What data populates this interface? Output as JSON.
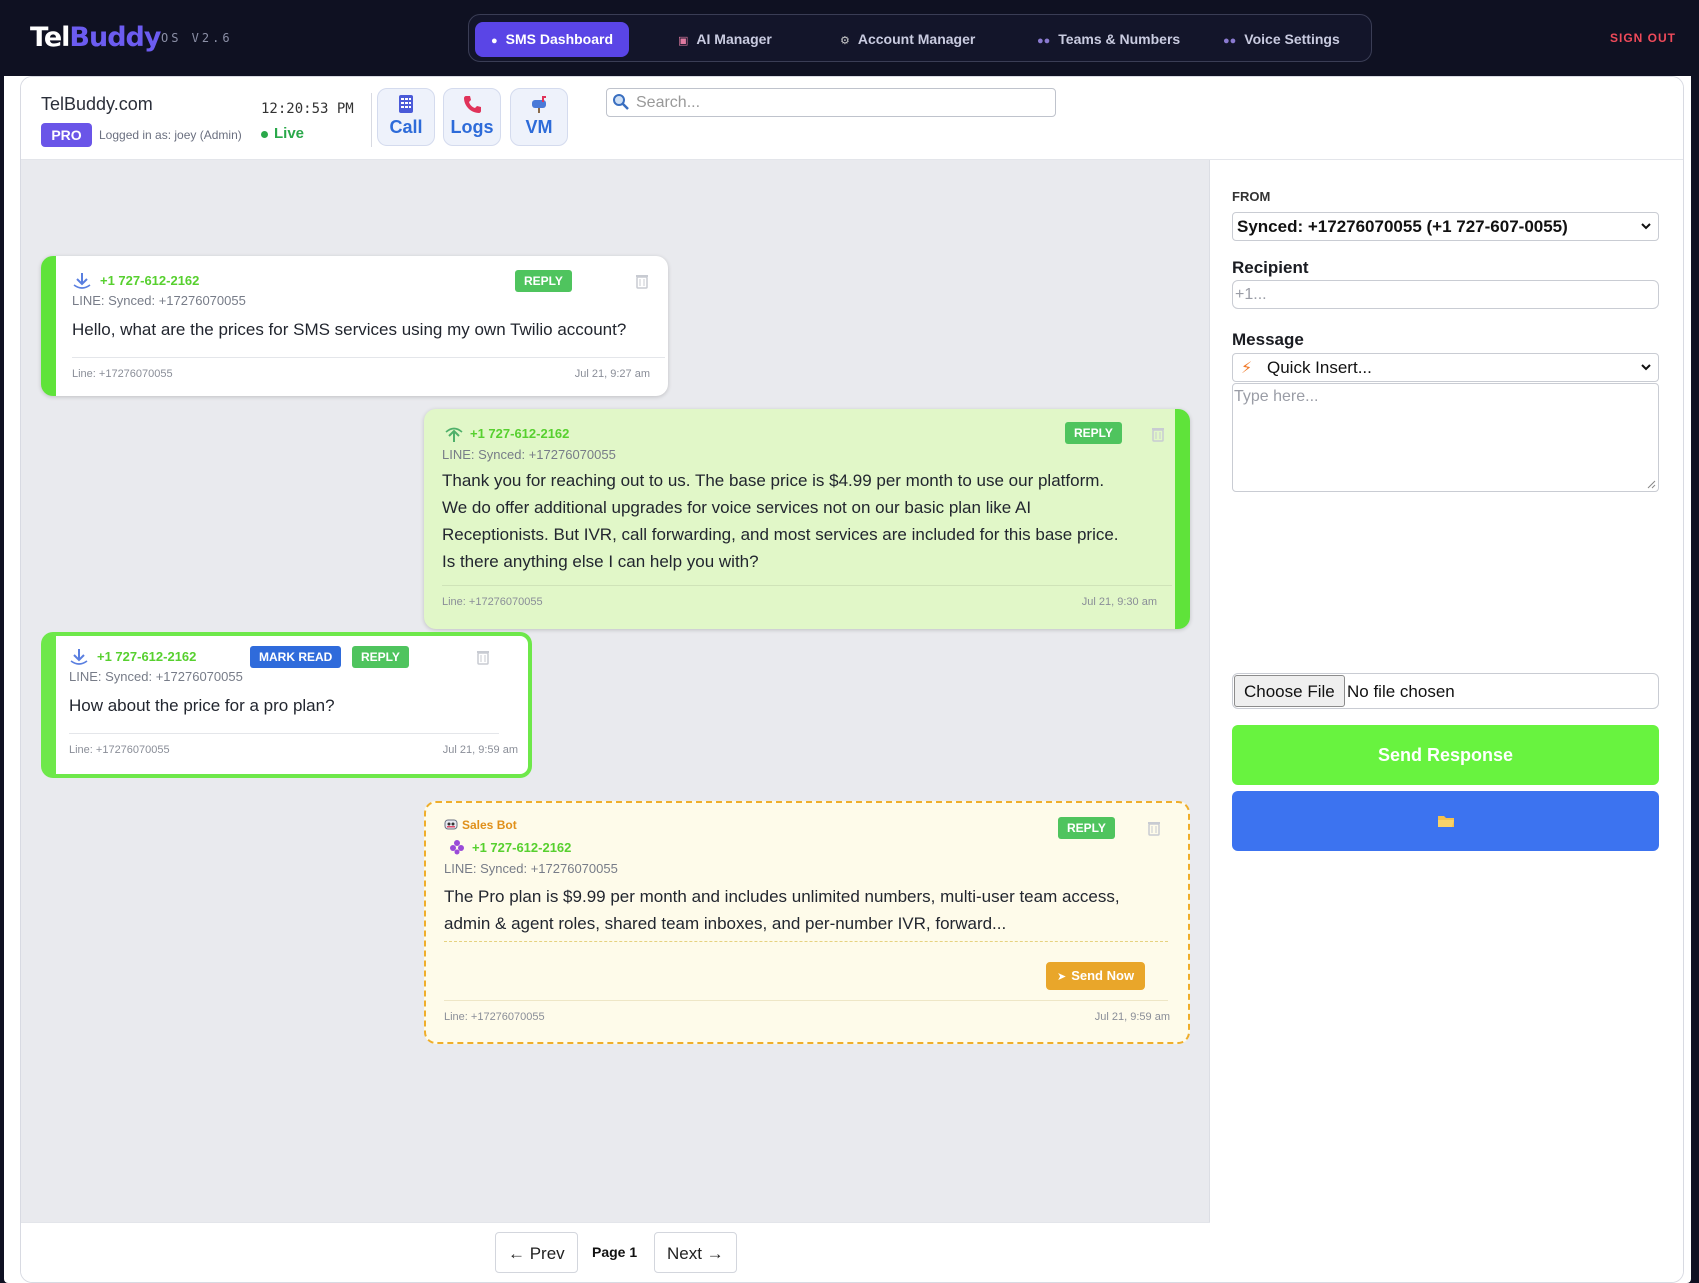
{
  "app": {
    "brand_a": "Tel",
    "brand_b": "Buddy",
    "version": "OS V2.6",
    "sign_out": "SIGN OUT"
  },
  "nav": [
    {
      "label": "SMS Dashboard",
      "icon": "chat-bubble-icon",
      "active": true
    },
    {
      "label": "AI Manager",
      "icon": "robot-icon",
      "active": false
    },
    {
      "label": "Account Manager",
      "icon": "gear-icon",
      "active": false
    },
    {
      "label": "Teams & Numbers",
      "icon": "people-icon",
      "active": false
    },
    {
      "label": "Voice Settings",
      "icon": "people-icon",
      "active": false
    }
  ],
  "header": {
    "site": "TelBuddy.com",
    "plan": "PRO",
    "logged_in": "Logged in as: joey (Admin)",
    "clock": "12:20:53 PM",
    "status": "Live",
    "quick": [
      {
        "label": "Call",
        "icon": "phone-keypad-icon"
      },
      {
        "label": "Logs",
        "icon": "phone-icon"
      },
      {
        "label": "VM",
        "icon": "mailbox-icon"
      }
    ],
    "search_placeholder": "Search..."
  },
  "messages": [
    {
      "direction": "inbound",
      "number": "+1 727-612-2162",
      "line": "LINE: Synced: +17276070055",
      "body": "Hello, what are the prices for SMS services using my own Twilio account?",
      "footer_line": "Line: +17276070055",
      "time": "Jul 21, 9:27 am",
      "actions": {
        "reply": "REPLY"
      }
    },
    {
      "direction": "outbound",
      "number": "+1 727-612-2162",
      "line": "LINE: Synced: +17276070055",
      "body_lines": [
        "Thank you for reaching out to us. The base price is $4.99 per month to use our platform.",
        "We do offer additional upgrades for voice services not on our basic plan like AI",
        "Receptionists. But IVR, call forwarding, and most services are included for this base price.",
        "Is there anything else I can help you with?"
      ],
      "footer_line": "Line: +17276070055",
      "time": "Jul 21, 9:30 am",
      "actions": {
        "reply": "REPLY"
      }
    },
    {
      "direction": "inbound",
      "unread": true,
      "number": "+1 727-612-2162",
      "line": "LINE: Synced: +17276070055",
      "body": "How about the price for a pro plan?",
      "footer_line": "Line: +17276070055",
      "time": "Jul 21, 9:59 am",
      "actions": {
        "mark_read": "MARK READ",
        "reply": "REPLY"
      }
    },
    {
      "direction": "draft",
      "bot_name": "Sales Bot",
      "number": "+1 727-612-2162",
      "line": "LINE: Synced: +17276070055",
      "body_lines": [
        "The Pro plan is $9.99 per month and includes unlimited numbers, multi-user team access,",
        "admin & agent roles, shared team inboxes, and per-number IVR, forward..."
      ],
      "send_now": "Send Now",
      "footer_line": "Line: +17276070055",
      "time": "Jul 21, 9:59 am",
      "actions": {
        "reply": "REPLY"
      }
    }
  ],
  "pager": {
    "prev": "← Prev",
    "page": "Page 1",
    "next": "Next →"
  },
  "compose": {
    "from_label": "FROM",
    "from_value": "Synced: +17276070055 (+1 727-607-0055)",
    "recipient_label": "Recipient",
    "recipient_placeholder": "+1...",
    "message_label": "Message",
    "quick_insert": "Quick Insert...",
    "message_placeholder": "Type here...",
    "file_button": "Choose File",
    "file_status": "No file chosen",
    "send_label": "Send Response",
    "attach_icon": "folder-icon"
  },
  "colors": {
    "accent": "#5a45e6",
    "green": "#68f33f",
    "blue": "#3c73f0",
    "bot_orange": "#e9a62a"
  }
}
